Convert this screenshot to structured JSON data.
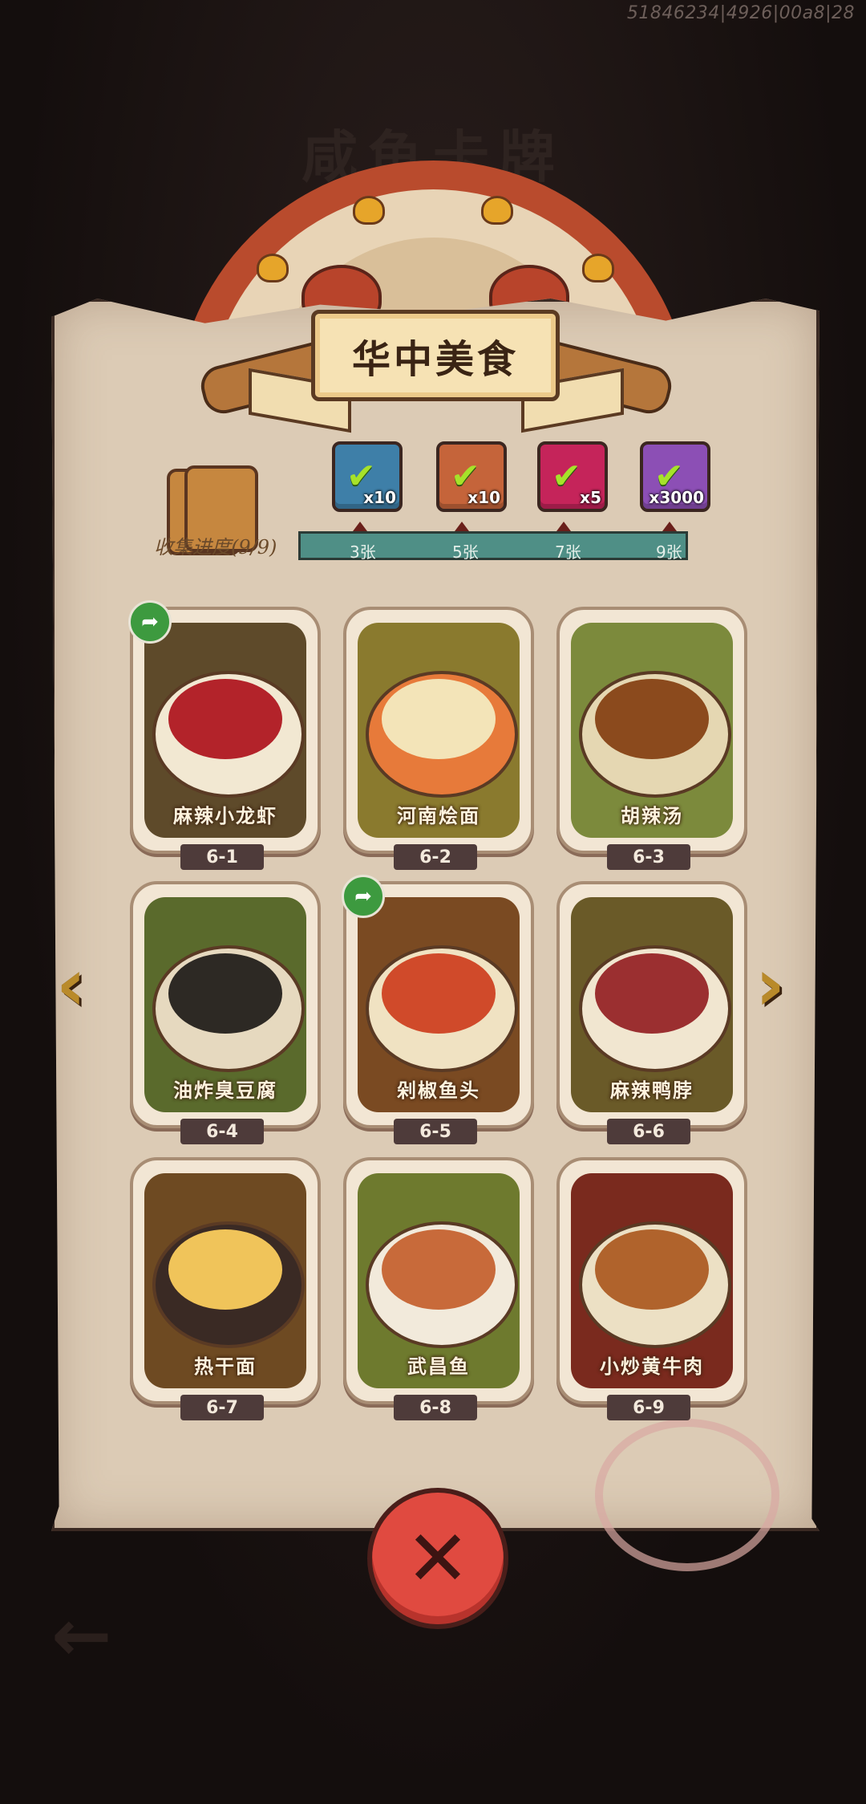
{
  "debug_id": "51846234|4926|00a8|28",
  "bg_title": "咸鱼卡牌",
  "banner": {
    "title": "华中美食"
  },
  "progress": {
    "label": "收集进度(9/9)",
    "collected": 9,
    "total": 9,
    "milestones": [
      {
        "label": "3张",
        "reward_icon": "chest-icon",
        "quantity": "x10",
        "claimed": true,
        "color": "#3e7fa8"
      },
      {
        "label": "5张",
        "reward_icon": "scroll-icon",
        "quantity": "x10",
        "claimed": true,
        "color": "#c5643a"
      },
      {
        "label": "7张",
        "reward_icon": "orb-icon",
        "quantity": "x5",
        "claimed": true,
        "color": "#c5245a"
      },
      {
        "label": "9张",
        "reward_icon": "gem-icon",
        "quantity": "x3000",
        "claimed": true,
        "color": "#8c4fb5"
      }
    ]
  },
  "cards": [
    {
      "id": "6-1",
      "name": "麻辣小龙虾",
      "has_share": true,
      "bg": "#5e4a2a",
      "bowl": "#f2e8d2",
      "food": "#b3232a"
    },
    {
      "id": "6-2",
      "name": "河南烩面",
      "has_share": false,
      "bg": "#8a7a2e",
      "bowl": "#e77a3a",
      "food": "#f3e4b8"
    },
    {
      "id": "6-3",
      "name": "胡辣汤",
      "has_share": false,
      "bg": "#7c8a3c",
      "bowl": "#e5d7b2",
      "food": "#8b4a1d"
    },
    {
      "id": "6-4",
      "name": "油炸臭豆腐",
      "has_share": false,
      "bg": "#5a6a2c",
      "bowl": "#e6d9bf",
      "food": "#2d2924"
    },
    {
      "id": "6-5",
      "name": "剁椒鱼头",
      "has_share": true,
      "bg": "#7a4a22",
      "bowl": "#f0e2c2",
      "food": "#d04a2a"
    },
    {
      "id": "6-6",
      "name": "麻辣鸭脖",
      "has_share": false,
      "bg": "#6a5a28",
      "bowl": "#f1e6d0",
      "food": "#9b2f30"
    },
    {
      "id": "6-7",
      "name": "热干面",
      "has_share": false,
      "bg": "#6e4a22",
      "bowl": "#3a2a24",
      "food": "#f0c45a"
    },
    {
      "id": "6-8",
      "name": "武昌鱼",
      "has_share": false,
      "bg": "#6e7a2e",
      "bowl": "#f2eadb",
      "food": "#c86a3a"
    },
    {
      "id": "6-9",
      "name": "小炒黄牛肉",
      "has_share": false,
      "bg": "#7a2a1e",
      "bowl": "#ece0c4",
      "food": "#b0632c"
    }
  ],
  "nav": {
    "prev_icon": "chevron-left-icon",
    "next_icon": "chevron-right-icon"
  },
  "close_icon": "close-icon"
}
